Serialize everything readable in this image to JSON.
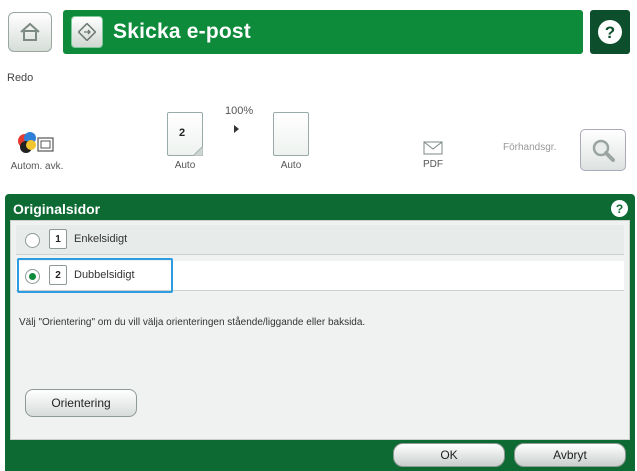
{
  "header": {
    "title": "Skicka e-post",
    "home_icon": "home-icon",
    "title_icon": "email-send-icon",
    "help_icon": "help-icon"
  },
  "status": {
    "state": "Redo"
  },
  "toolbar": {
    "color_label": "Autom. avk.",
    "original_label": "Auto",
    "zoom_value": "100%",
    "output_label": "Auto",
    "format_label": "PDF",
    "preview_label": "Förhandsgr.",
    "original_number": "2"
  },
  "dialog": {
    "title": "Originalsidor",
    "options": [
      {
        "label": "Enkelsidigt",
        "number": "1",
        "selected": false
      },
      {
        "label": "Dubbelsidigt",
        "number": "2",
        "selected": true
      }
    ],
    "hint": "Välj \"Orientering\" om du vill välja orienteringen stående/liggande eller baksida.",
    "orientation_button": "Orientering",
    "ok_button": "OK",
    "cancel_button": "Avbryt"
  },
  "colors": {
    "primary_green": "#0d8a3a",
    "dialog_green": "#0d6a33",
    "highlight_blue": "#2d9de0"
  }
}
